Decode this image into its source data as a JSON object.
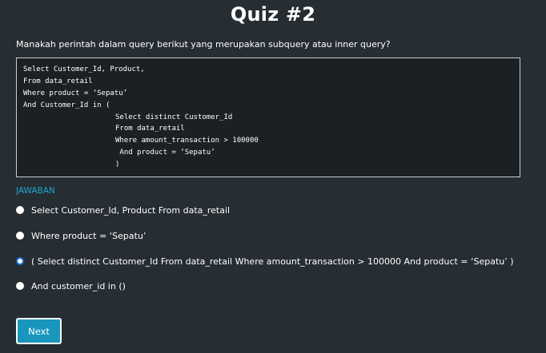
{
  "quiz": {
    "title": "Quiz #2",
    "question": "Manakah perintah dalam query berikut yang merupakan subquery atau inner query?",
    "code_lines": [
      "Select Customer_Id, Product,",
      "From data_retail",
      "Where product = ‘Sepatu’",
      "And Customer_Id in (",
      "Select distinct Customer_Id",
      "From data_retail",
      "Where amount_transaction > 100000",
      " And product = ‘Sepatu’",
      ")"
    ],
    "answer_label": "JAWABAN",
    "options": [
      {
        "label": "Select Customer_Id, Product From data_retail",
        "selected": false
      },
      {
        "label": "Where product = ‘Sepatu’",
        "selected": false
      },
      {
        "label": "( Select distinct Customer_Id From data_retail Where amount_transaction > 100000 And product = ‘Sepatu’ )",
        "selected": true
      },
      {
        "label": "And customer_id in ()",
        "selected": false
      }
    ],
    "next_label": "Next"
  },
  "colors": {
    "background": "#262d33",
    "code_background": "#1b2024",
    "accent": "#21a6cf",
    "button": "#1896bd",
    "radio_selected": "#1e6fd9"
  }
}
